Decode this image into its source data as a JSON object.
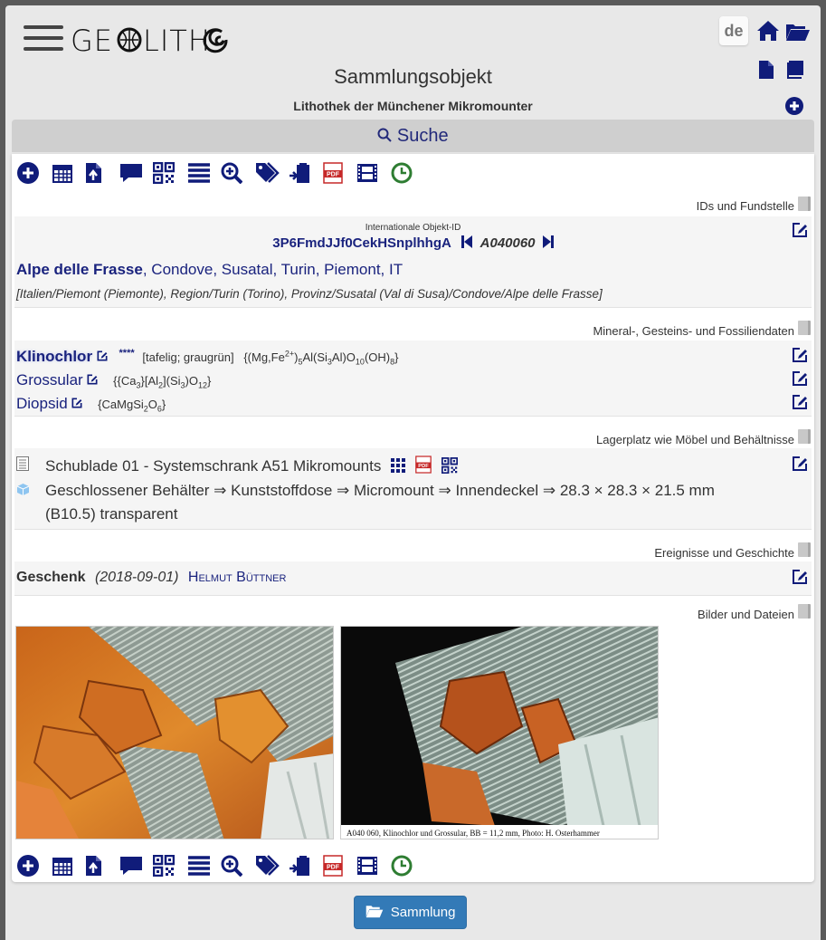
{
  "header": {
    "logo_text": "GEOLITHO",
    "lang_label": "de",
    "page_title": "Sammlungsobjekt",
    "collection_name": "Lithothek der Münchener Mikromounter",
    "search_label": "Suche"
  },
  "toolbar": {
    "icons": [
      "add-icon",
      "calendar-icon",
      "upload-icon",
      "comment-icon",
      "qr-code-icon",
      "list-icon",
      "zoom-icon",
      "tags-icon",
      "clipboard-icon",
      "pdf-icon",
      "film-icon",
      "clock-icon"
    ]
  },
  "sections": {
    "ids": {
      "label": "IDs und Fundstelle",
      "intl_id_label": "Internationale Objekt-ID",
      "intl_id": "3P6FmdJJf0CekHSnplhhgA",
      "local_id": "A040060",
      "locality_main": "Alpe delle Frasse",
      "locality_rest": ", Condove, Susatal, Turin, Piemont, IT",
      "locality_path": "[Italien/Piemont (Piemonte), Region/Turin (Torino), Provinz/Susatal (Val di Susa)/Condove/Alpe delle Frasse]"
    },
    "minerals": {
      "label": "Mineral-, Gesteins- und Fossiliendaten",
      "items": [
        {
          "name": "Klinochlor",
          "stars": "****",
          "desc": "[tafelig; graugrün]"
        },
        {
          "name": "Grossular",
          "stars": "",
          "desc": ""
        },
        {
          "name": "Diopsid",
          "stars": "",
          "desc": ""
        }
      ]
    },
    "storage": {
      "label": "Lagerplatz wie Möbel und Behältnisse",
      "location": "Schublade 01 - Systemschrank A51 Mikromounts",
      "container": "Geschlossener Behälter ⇒ Kunststoffdose ⇒ Micromount ⇒ Innendeckel ⇒ 28.3 × 28.3 × 21.5 mm (B10.5) transparent"
    },
    "events": {
      "label": "Ereignisse und Geschichte",
      "type": "Geschenk",
      "date": "(2018-09-01)",
      "person": "Helmut Büttner"
    },
    "images": {
      "label": "Bilder und Dateien",
      "caption": "A040 060, Klinochlor und Grossular, BB = 11,2 mm, Photo: H. Osterhammer"
    }
  },
  "footer": {
    "button_label": "Sammlung"
  },
  "colors": {
    "accent": "#1a237e",
    "button": "#337ab7",
    "pdf_red": "#c62828",
    "clock_green": "#2e7d32"
  }
}
